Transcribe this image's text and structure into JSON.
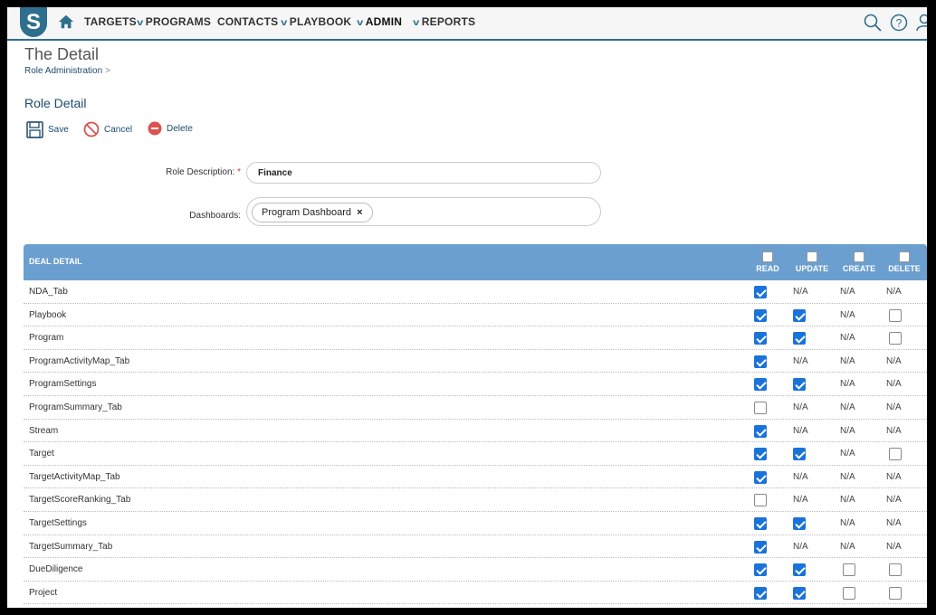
{
  "nav": {
    "logo": "S",
    "items": [
      {
        "label": "TARGETS",
        "chevron": false
      },
      {
        "label": "PROGRAMS",
        "chevron": true
      },
      {
        "label": "CONTACTS",
        "chevron": false
      },
      {
        "label": "PLAYBOOK",
        "chevron": true
      },
      {
        "label": "ADMIN",
        "chevron": true
      },
      {
        "label": "REPORTS",
        "chevron": true
      }
    ]
  },
  "page": {
    "title": "The Detail",
    "breadcrumb": "Role Administration",
    "breadcrumb_sep": ">",
    "section_title": "Role Detail"
  },
  "actions": {
    "save": "Save",
    "cancel": "Cancel",
    "delete": "Delete"
  },
  "form": {
    "role_label": "Role Description:",
    "role_required": "*",
    "role_value": "Finance",
    "dash_label": "Dashboards:",
    "dash_tag": "Program Dashboard",
    "dash_tag_remove": "×"
  },
  "table": {
    "title": "DEAL DETAIL",
    "columns": [
      "READ",
      "UPDATE",
      "CREATE",
      "DELETE"
    ],
    "na_text": "N/A",
    "rows": [
      {
        "name": "NDA_Tab",
        "cells": [
          true,
          "N/A",
          "N/A",
          "N/A"
        ]
      },
      {
        "name": "Playbook",
        "cells": [
          true,
          true,
          "N/A",
          false
        ]
      },
      {
        "name": "Program",
        "cells": [
          true,
          true,
          "N/A",
          false
        ]
      },
      {
        "name": "ProgramActivityMap_Tab",
        "cells": [
          true,
          "N/A",
          "N/A",
          "N/A"
        ]
      },
      {
        "name": "ProgramSettings",
        "cells": [
          true,
          true,
          "N/A",
          "N/A"
        ]
      },
      {
        "name": "ProgramSummary_Tab",
        "cells": [
          false,
          "N/A",
          "N/A",
          "N/A"
        ]
      },
      {
        "name": "Stream",
        "cells": [
          true,
          "N/A",
          "N/A",
          "N/A"
        ]
      },
      {
        "name": "Target",
        "cells": [
          true,
          true,
          "N/A",
          false
        ]
      },
      {
        "name": "TargetActivityMap_Tab",
        "cells": [
          true,
          "N/A",
          "N/A",
          "N/A"
        ]
      },
      {
        "name": "TargetScoreRanking_Tab",
        "cells": [
          false,
          "N/A",
          "N/A",
          "N/A"
        ]
      },
      {
        "name": "TargetSettings",
        "cells": [
          true,
          true,
          "N/A",
          "N/A"
        ]
      },
      {
        "name": "TargetSummary_Tab",
        "cells": [
          true,
          "N/A",
          "N/A",
          "N/A"
        ]
      },
      {
        "name": "DueDiligence",
        "cells": [
          true,
          true,
          false,
          false
        ]
      },
      {
        "name": "Project",
        "cells": [
          true,
          true,
          false,
          false
        ]
      }
    ]
  },
  "colors": {
    "nav_accent": "#2f6f8e",
    "table_header": "#6b9fcf",
    "checkbox_on": "#1a73d9",
    "delete_red": "#d9534f"
  }
}
